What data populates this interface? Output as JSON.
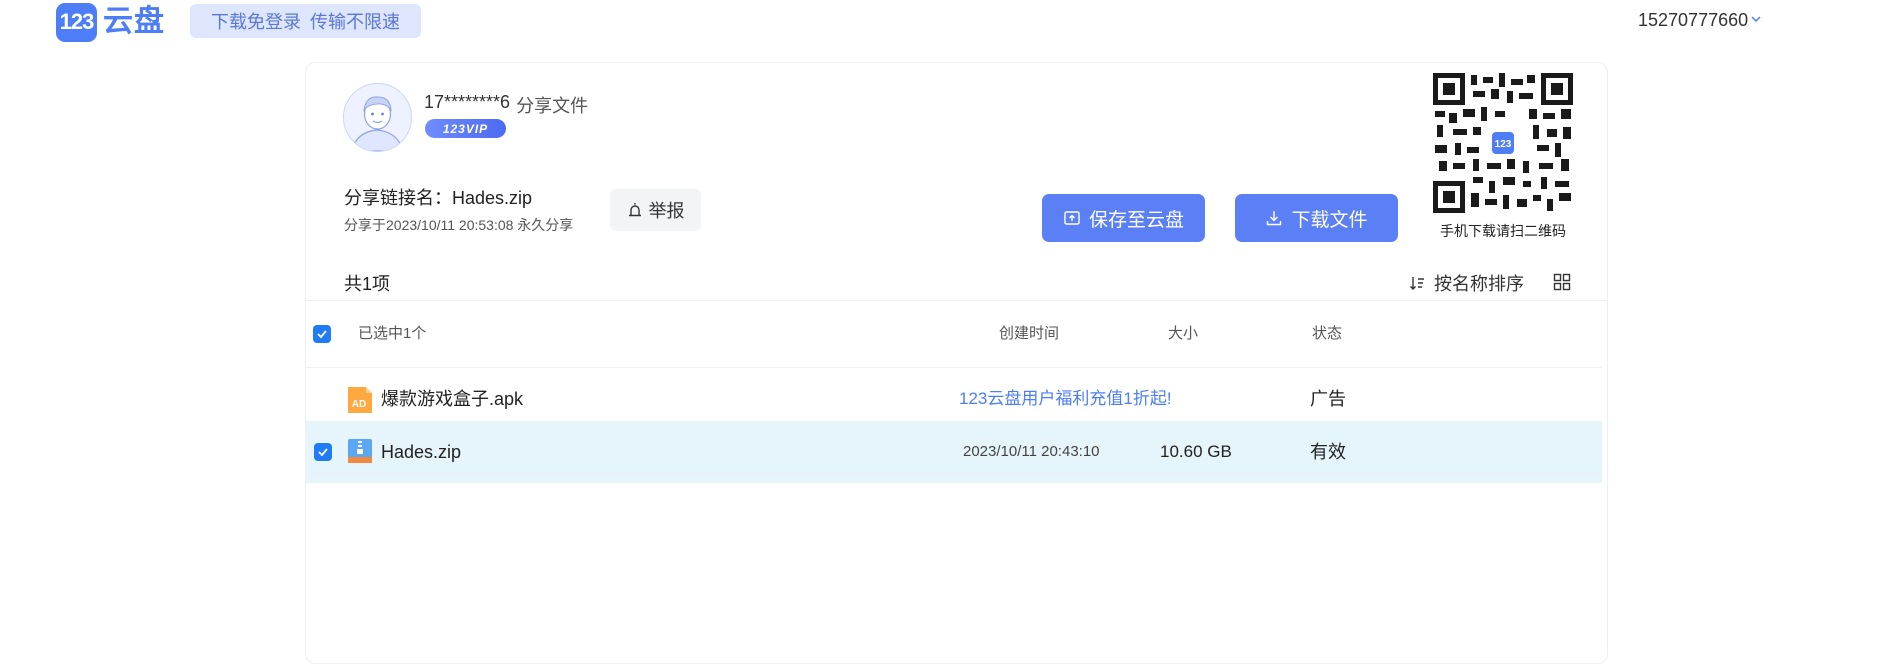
{
  "brand": {
    "logo_mark": "123",
    "logo_text": "云盘",
    "color": "#4d7ef7"
  },
  "header": {
    "slogan": "下载免登录  传输不限速",
    "account": "15270777660"
  },
  "share": {
    "owner": "17********6",
    "owner_suffix": "分享文件",
    "vip_badge": "123VIP",
    "link_name": "分享链接名：Hades.zip",
    "shared_at": "分享于2023/10/11 20:53:08 永久分享",
    "report_label": "举报",
    "save_label": "保存至云盘",
    "download_label": "下载文件",
    "qr_caption": "手机下载请扫二维码"
  },
  "list": {
    "count_label": "共1项",
    "sort_label": "按名称排序",
    "columns": {
      "selected": "已选中1个",
      "created": "创建时间",
      "size": "大小",
      "status": "状态"
    },
    "rows": [
      {
        "icon": "ad-file-icon",
        "name": "爆款游戏盒子.apk",
        "created": "123云盘用户福利充值1折起!",
        "size": "",
        "status": "广告",
        "checked": false
      },
      {
        "icon": "zip-file-icon",
        "name": "Hades.zip",
        "created": "2023/10/11 20:43:10",
        "size": "10.60 GB",
        "status": "有效",
        "checked": true
      }
    ]
  },
  "colors": {
    "primary": "#5b80f5",
    "checkbox": "#1f7cf5",
    "selected_row": "#e5f5fb",
    "ad_link": "#4d7ef7"
  }
}
